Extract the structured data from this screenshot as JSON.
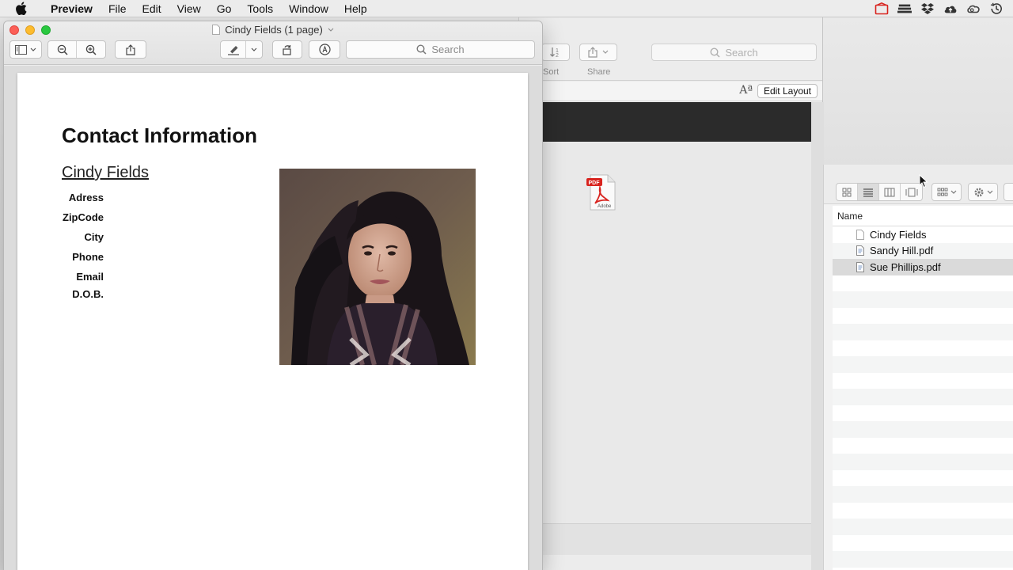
{
  "menubar": {
    "app_name": "Preview",
    "items": [
      "File",
      "Edit",
      "View",
      "Go",
      "Tools",
      "Window",
      "Help"
    ]
  },
  "preview": {
    "title": "Cindy Fields (1 page)",
    "search_placeholder": "Search",
    "document": {
      "heading": "Contact Information",
      "name": "Cindy Fields",
      "fields": [
        "Adress",
        "ZipCode",
        "City",
        "Phone",
        "Email",
        "D.O.B."
      ]
    }
  },
  "middle_window": {
    "sort_label": "Sort",
    "share_label": "Share",
    "search_placeholder": "Search",
    "edit_layout": "Edit Layout",
    "text_size_glyph": "Aª"
  },
  "finder": {
    "column_header": "Name",
    "files": [
      {
        "name": "Cindy Fields",
        "selected": false
      },
      {
        "name": "Sandy Hill.pdf",
        "selected": false
      },
      {
        "name": "Sue Phillips.pdf",
        "selected": true
      }
    ]
  },
  "colors": {
    "close": "#fc5f57",
    "minimize": "#fdbc2e",
    "maximize": "#29c840",
    "pdf_red": "#d8231e"
  }
}
